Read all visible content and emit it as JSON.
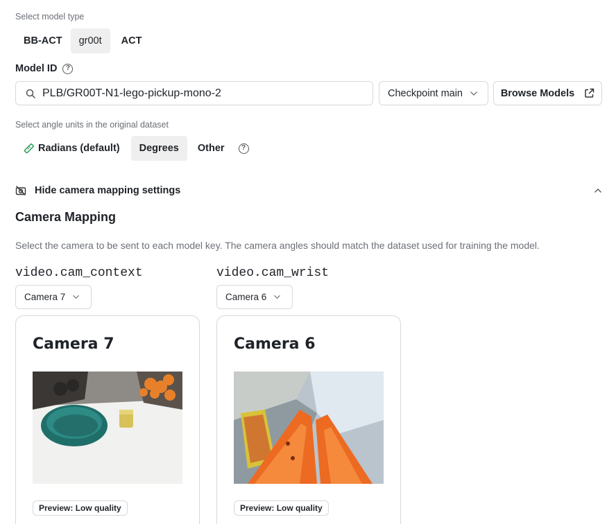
{
  "model_type": {
    "label": "Select model type",
    "options": [
      "BB-ACT",
      "gr00t",
      "ACT"
    ],
    "selected": "gr00t"
  },
  "model_id": {
    "label": "Model ID",
    "value": "PLB/GR00T-N1-lego-pickup-mono-2",
    "checkpoint": "Checkpoint main",
    "browse_label": "Browse Models"
  },
  "angle_units": {
    "label": "Select angle units in the original dataset",
    "options": [
      "Radians (default)",
      "Degrees",
      "Other"
    ],
    "selected": "Degrees"
  },
  "camera_toggle": {
    "label": "Hide camera mapping settings"
  },
  "camera_mapping": {
    "title": "Camera Mapping",
    "description": "Select the camera to be sent to each model key. The camera angles should match the dataset used for training the model.",
    "keys": [
      {
        "key": "video.cam_context",
        "selected": "Camera 7",
        "card_title": "Camera 7",
        "preview": "Preview: Low quality"
      },
      {
        "key": "video.cam_wrist",
        "selected": "Camera 6",
        "card_title": "Camera 6",
        "preview": "Preview: Low quality"
      }
    ]
  },
  "icons": {
    "search": "search-icon",
    "help": "help-circle-icon",
    "chevron": "chevron-down-icon",
    "external": "external-link-icon",
    "ruler": "ruler-icon",
    "camera_off": "camera-off-icon",
    "collapse": "chevron-up-icon"
  }
}
